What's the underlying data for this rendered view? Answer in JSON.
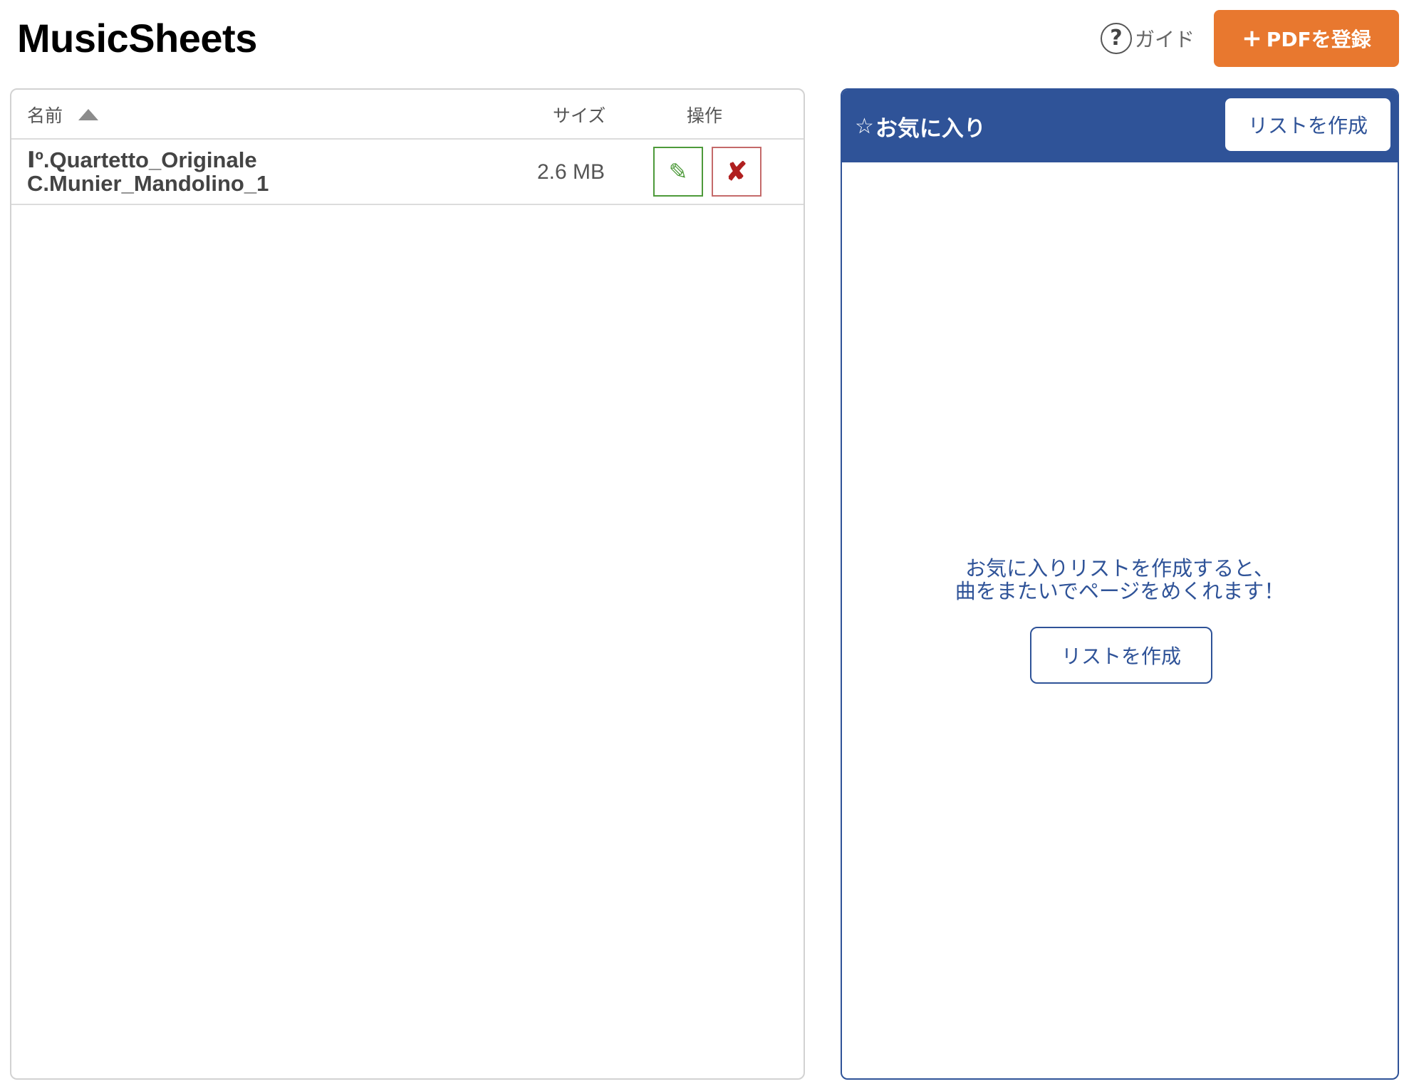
{
  "app": {
    "title": "MusicSheets"
  },
  "header": {
    "guide_label": "ガイド",
    "guide_icon": "question-circle-icon",
    "guide_icon_glyph": "?",
    "add_pdf_icon_glyph": "+",
    "add_pdf_label": "PDFを登録"
  },
  "file_table": {
    "columns": {
      "name": "名前",
      "size": "サイズ",
      "operations": "操作"
    },
    "sort": {
      "column": "name",
      "direction": "asc"
    },
    "rows": [
      {
        "name_line1": "Ⅰº.Quartetto_Originale",
        "name_line2": "C.Munier_Mandolino_1",
        "size": "2.6 MB",
        "edit_icon_glyph": "✎",
        "delete_icon_glyph": "✘"
      }
    ]
  },
  "favorites": {
    "star_glyph": "☆",
    "title": "お気に入り",
    "create_list_label": "リストを作成",
    "empty_message_line1": "お気に入りリストを作成すると、",
    "empty_message_line2": "曲をまたいでページをめくれます！",
    "create_list_body_label": "リストを作成"
  },
  "colors": {
    "accent_orange": "#E8782F",
    "favorites_blue": "#2F5398",
    "edit_green": "#4d9a3a",
    "delete_red": "#b01f1f"
  }
}
